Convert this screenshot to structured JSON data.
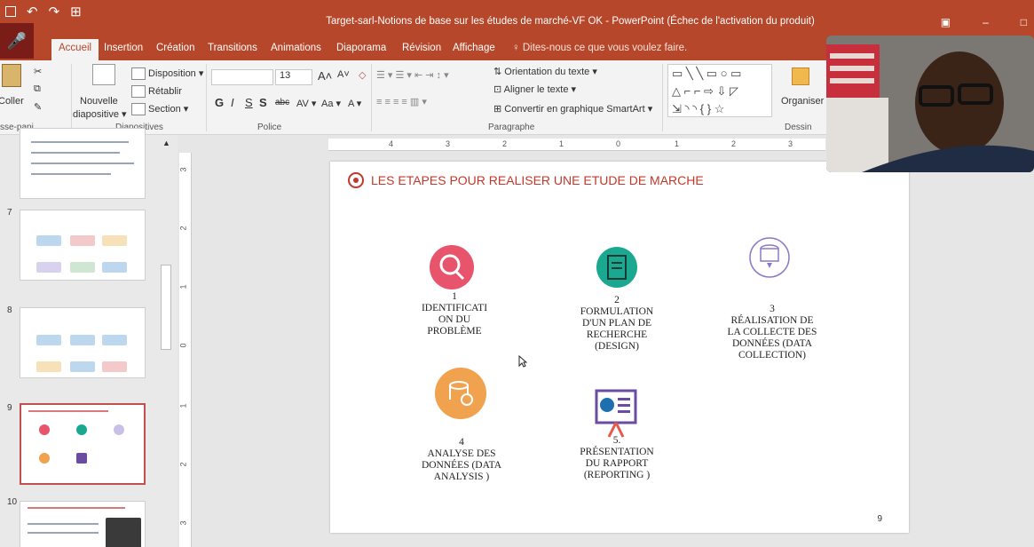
{
  "titlebar": {
    "title": "Target-sarl-Notions de base sur les études de marché-VF OK - PowerPoint (Échec de l'activation du produit)",
    "minimize": "–",
    "restore": "□"
  },
  "tabs": [
    {
      "label": "Accueil"
    },
    {
      "label": "Insertion"
    },
    {
      "label": "Création"
    },
    {
      "label": "Transitions"
    },
    {
      "label": "Animations"
    },
    {
      "label": "Diaporama"
    },
    {
      "label": "Révision"
    },
    {
      "label": "Affichage"
    }
  ],
  "search_placeholder": "Dites-nous ce que vous voulez faire.",
  "ribbon": {
    "coller": "Coller",
    "presse_papiers": "sse-papi...",
    "nouvelle": "Nouvelle",
    "diapositive": "diapositive",
    "disposition": "Disposition",
    "retablir": "Rétablir",
    "section": "Section",
    "diapositives": "Diapositives",
    "font_size": "13",
    "police": "Police",
    "orientation": "Orientation du texte",
    "aligner": "Aligner le texte",
    "convertir": "Convertir en graphique SmartArt",
    "paragraphe": "Paragraphe",
    "organiser": "Organiser",
    "dessin": "Dessin"
  },
  "thumbnails": [
    {
      "number": "7"
    },
    {
      "number": "8"
    },
    {
      "number": "9"
    },
    {
      "number": "10"
    }
  ],
  "slide": {
    "title": "LES ETAPES POUR REALISER UNE ETUDE DE MARCHE",
    "page_number": "9",
    "steps": [
      {
        "text": "1\nIDENTIFICATI\nON DU\nPROBLÈME",
        "color": "#e8546b"
      },
      {
        "text": "2\nFORMULATION\nD'UN PLAN DE\nRECHERCHE\n(DESIGN)",
        "color": "#1aa890"
      },
      {
        "text": "3\nRÉALISATION DE\nLA COLLECTE DES\nDONNÉES (DATA\nCOLLECTION)",
        "color": "#8d79c7"
      },
      {
        "text": "4\nANALYSE DES\nDONNÉES (DATA\nANALYSIS )",
        "color": "#f0a24e"
      },
      {
        "text": "5.\nPRÉSENTATION\nDU RAPPORT\n(REPORTING )",
        "color": "#6a4ca0"
      }
    ]
  },
  "ruler": {
    "h": [
      "4",
      "3",
      "2",
      "1",
      "0",
      "1",
      "2",
      "3"
    ],
    "v": [
      "3",
      "2",
      "1",
      "0",
      "1",
      "2",
      "3"
    ]
  }
}
